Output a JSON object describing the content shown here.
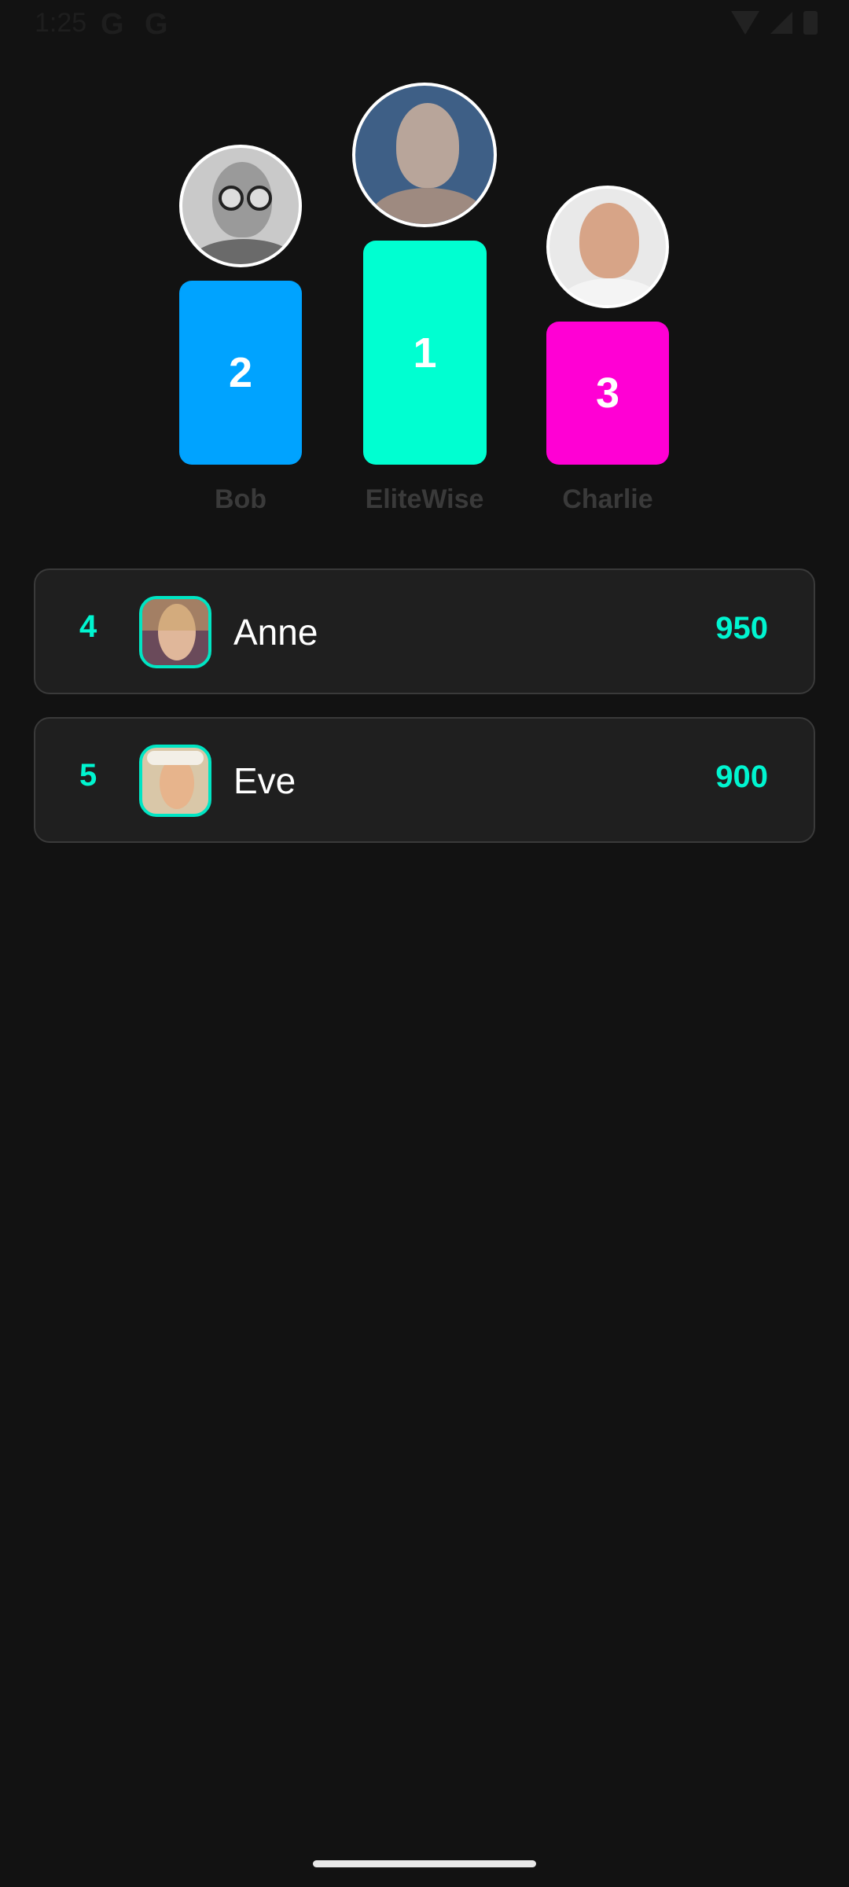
{
  "status_bar": {
    "time": "1:25",
    "g1": "G",
    "g2": "G"
  },
  "podium": [
    {
      "rank": "2",
      "name": "Bob",
      "color": "#00a3ff"
    },
    {
      "rank": "1",
      "name": "EliteWise",
      "color": "#00ffd1"
    },
    {
      "rank": "3",
      "name": "Charlie",
      "color": "#ff00d4"
    }
  ],
  "list": [
    {
      "rank": "4",
      "name": "Anne",
      "score": "950"
    },
    {
      "rank": "5",
      "name": "Eve",
      "score": "900"
    }
  ],
  "accent": "#00f5d0"
}
